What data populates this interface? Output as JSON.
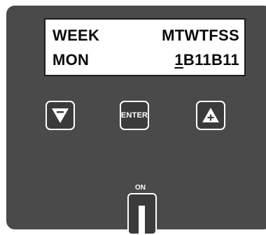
{
  "display": {
    "row1_left": "WEEK",
    "row1_right": "MTWTFSS",
    "row2_left": "MON",
    "row2_cursor": "1",
    "row2_rest": "B11B11"
  },
  "buttons": {
    "down_icon": "triangle-down-minus-icon",
    "enter_label": "ENTER",
    "up_icon": "triangle-up-plus-icon"
  },
  "power": {
    "label": "ON"
  },
  "colors": {
    "panel": "#4a4a4a",
    "lcd_background": "#ffffff",
    "button_border": "#ffffff"
  }
}
